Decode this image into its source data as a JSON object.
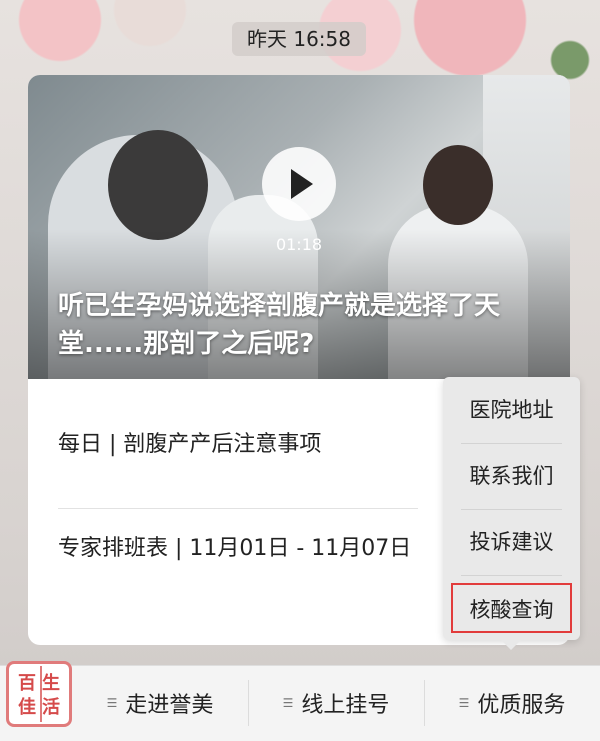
{
  "header": {
    "timestamp": "昨天 16:58"
  },
  "video": {
    "duration": "01:18",
    "title": "听已生孕妈说选择剖腹产就是选择了天堂......那剖了之后呢?"
  },
  "articles": [
    {
      "title": "每日 | 剖腹产产后注意事项"
    },
    {
      "title": "专家排班表 | 11月01日 - 11月07日"
    }
  ],
  "popup_menu": {
    "items": [
      {
        "label": "医院地址"
      },
      {
        "label": "联系我们"
      },
      {
        "label": "投诉建议"
      },
      {
        "label": "核酸查询",
        "highlighted": true
      }
    ],
    "highlight_color": "#e23c3c"
  },
  "bottom_menu": {
    "logo_chars": [
      "百",
      "生",
      "佳",
      "活"
    ],
    "tabs": [
      {
        "label": "走进誉美",
        "icon": "menu-icon"
      },
      {
        "label": "线上挂号",
        "icon": "menu-icon"
      },
      {
        "label": "优质服务",
        "icon": "menu-icon"
      }
    ]
  }
}
